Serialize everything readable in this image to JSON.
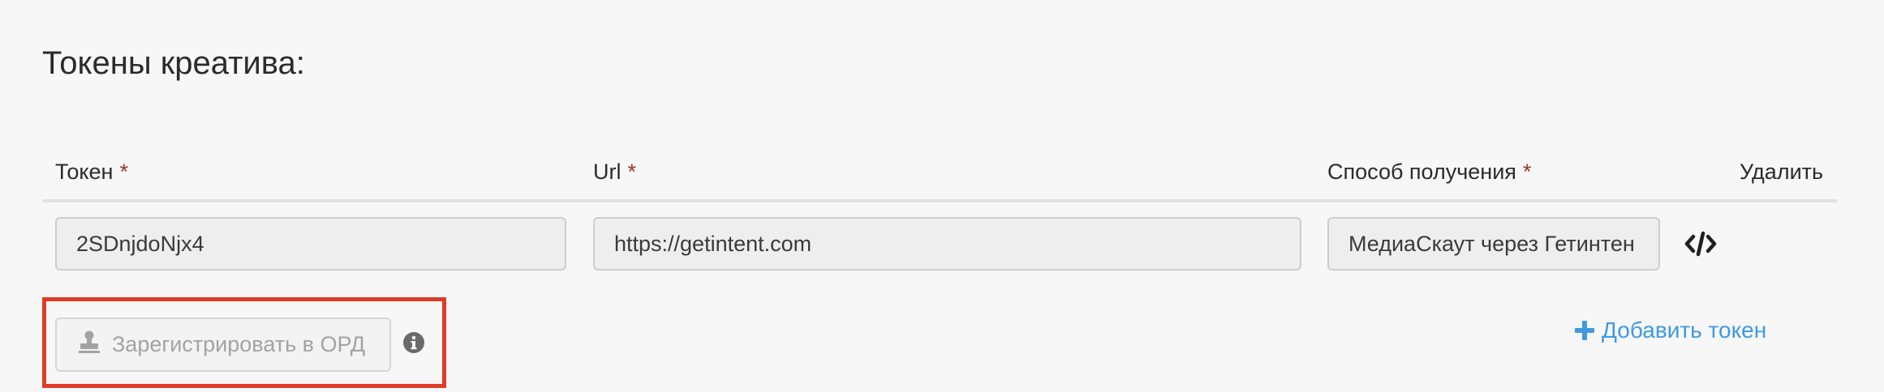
{
  "section": {
    "title": "Токены креатива:"
  },
  "columns": {
    "token": {
      "label": "Токен",
      "required_mark": "*"
    },
    "url": {
      "label": "Url",
      "required_mark": "*"
    },
    "method": {
      "label": "Способ получения",
      "required_mark": "*"
    },
    "delete": {
      "label": "Удалить"
    }
  },
  "rows": [
    {
      "token": "2SDnjdoNjx4",
      "url": "https://getintent.com",
      "method": "МедиаСкаут через Гетинтен"
    }
  ],
  "actions": {
    "register_ord_label": "Зарегистрировать в ОРД",
    "add_token_label": "Добавить токен"
  },
  "icons": {
    "stamp": "stamp-icon",
    "info": "info-icon",
    "code": "code-icon",
    "plus": "plus-icon"
  },
  "colors": {
    "accent_link": "#3f9ae0",
    "required_mark": "#a33030",
    "highlight_border": "#e03b28"
  }
}
